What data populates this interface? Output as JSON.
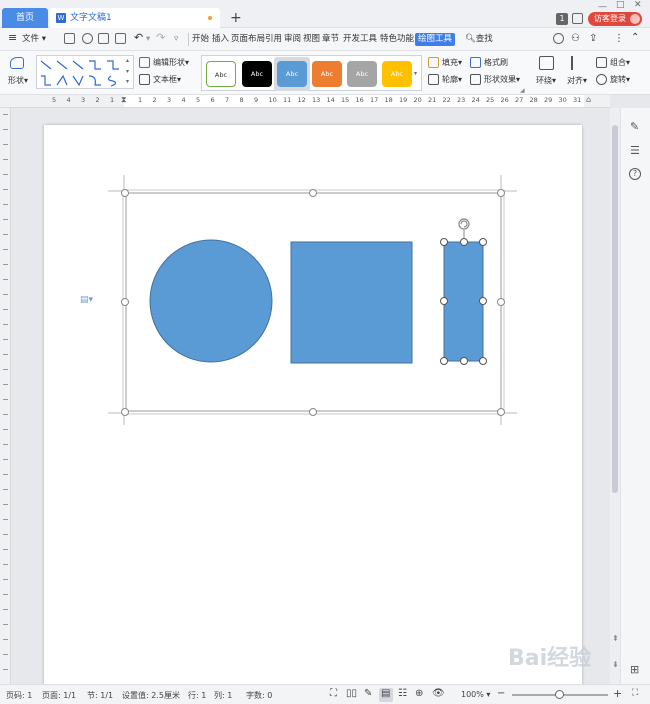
{
  "titlebar": {
    "home_tab": "首页",
    "doc_tab": "文字文稿1",
    "badge": "1",
    "login": "访客登录"
  },
  "menubar": {
    "file": "文件",
    "items": [
      "开始",
      "插入",
      "页面布局",
      "引用",
      "审阅",
      "视图",
      "章节",
      "开发工具",
      "特色功能",
      "绘图工具"
    ],
    "search": "查找"
  },
  "ribbon": {
    "shape": "形状",
    "edit_shape": "编辑形状",
    "text_box": "文本框",
    "style_label": "Abc",
    "fill": "填充",
    "format_painter": "格式刷",
    "outline": "轮廓",
    "shape_effect": "形状效果",
    "wrap": "环绕",
    "align": "对齐",
    "group": "组合",
    "rotate": "旋转",
    "style_colors": [
      "#ffffff",
      "#000000",
      "#5b9bd5",
      "#ed7d31",
      "#a5a5a5",
      "#ffc000"
    ]
  },
  "ruler": {
    "h_ticks": [
      "5",
      "4",
      "3",
      "2",
      "1",
      "1",
      "2",
      "3",
      "4",
      "5",
      "6",
      "7",
      "8",
      "9",
      "10",
      "11",
      "12",
      "13",
      "14",
      "15",
      "16",
      "17",
      "18",
      "19",
      "20",
      "21",
      "22",
      "23",
      "24",
      "25",
      "26",
      "27",
      "28",
      "29",
      "30",
      "31"
    ]
  },
  "shapes": {
    "fill": "#5b9bd5",
    "stroke": "#41719c"
  },
  "statusbar": {
    "page_num": "页码: 1",
    "pages": "页面: 1/1",
    "section": "节: 1/1",
    "setting": "设置值: 2.5厘米",
    "row": "行: 1",
    "col": "列: 1",
    "words": "字数: 0",
    "zoom": "100%"
  },
  "watermark": "Bai经验"
}
